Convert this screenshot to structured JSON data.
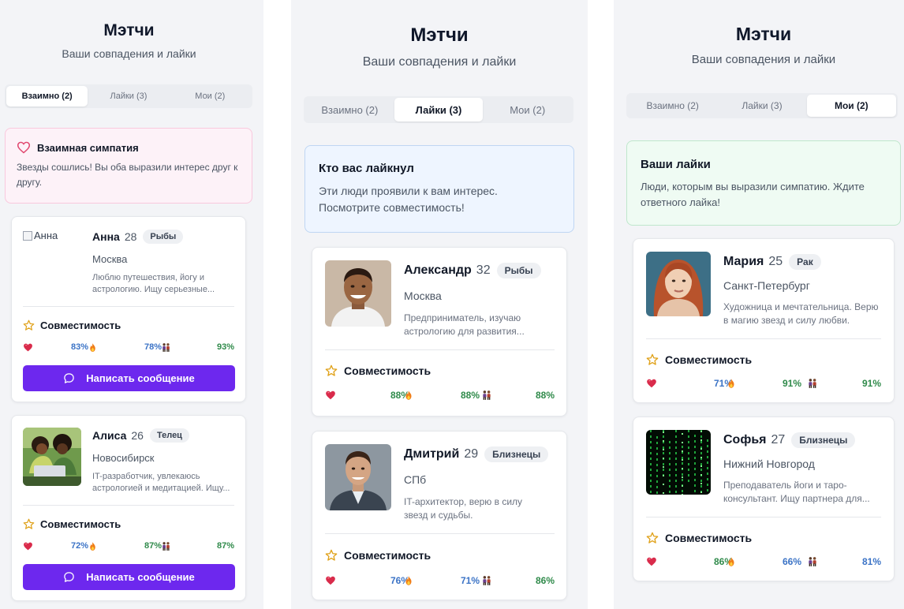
{
  "colors": {
    "accent_purple": "#6d28ee",
    "pct_blue": "#3b73c6",
    "pct_green": "#2f8a4a",
    "banner_pink": "#fdf2f8",
    "banner_blue": "#eef5ff",
    "banner_green": "#effbf3"
  },
  "panels": [
    {
      "title": "Мэтчи",
      "subtitle": "Ваши совпадения и лайки",
      "tabs": [
        {
          "label": "Взаимно (2)",
          "active": true
        },
        {
          "label": "Лайки (3)",
          "active": false
        },
        {
          "label": "Мои (2)",
          "active": false
        }
      ],
      "banner": {
        "icon": "heart-outline-icon",
        "title": "Взаимная симпатия",
        "text": "Звезды сошлись! Вы оба выразили интерес друг к другу."
      },
      "cards": [
        {
          "name": "Анна",
          "age": "28",
          "sign": "Рыбы",
          "city": "Москва",
          "description": "Люблю путешествия, йогу и астрологию. Ищу серьезные...",
          "photo": "broken",
          "photo_alt": "Анна",
          "compat_label": "Совместимость",
          "stats": [
            {
              "icon": "heart-icon",
              "value": "83%",
              "color": "blue"
            },
            {
              "icon": "fire-icon",
              "value": "78%",
              "color": "blue"
            },
            {
              "icon": "couple-icon",
              "value": "93%",
              "color": "green"
            }
          ],
          "button_label": "Написать сообщение"
        },
        {
          "name": "Алиса",
          "age": "26",
          "sign": "Телец",
          "city": "Новосибирск",
          "description": "IT-разработчик, увлекаюсь астрологией и медитацией. Ищу...",
          "photo": "friends-laptop",
          "compat_label": "Совместимость",
          "stats": [
            {
              "icon": "heart-icon",
              "value": "72%",
              "color": "blue"
            },
            {
              "icon": "fire-icon",
              "value": "87%",
              "color": "green"
            },
            {
              "icon": "couple-icon",
              "value": "87%",
              "color": "green"
            }
          ],
          "button_label": "Написать сообщение"
        }
      ]
    },
    {
      "title": "Мэтчи",
      "subtitle": "Ваши совпадения и лайки",
      "tabs": [
        {
          "label": "Взаимно (2)",
          "active": false
        },
        {
          "label": "Лайки (3)",
          "active": true
        },
        {
          "label": "Мои (2)",
          "active": false
        }
      ],
      "banner": {
        "title": "Кто вас лайкнул",
        "text": "Эти люди проявили к вам интерес. Посмотрите совместимость!"
      },
      "cards": [
        {
          "name": "Александр",
          "age": "32",
          "sign": "Рыбы",
          "city": "Москва",
          "description": "Предприниматель, изучаю астрологию для развития...",
          "photo": "man-smiling",
          "compat_label": "Совместимость",
          "stats": [
            {
              "icon": "heart-icon",
              "value": "88%",
              "color": "green"
            },
            {
              "icon": "fire-icon",
              "value": "88%",
              "color": "green"
            },
            {
              "icon": "couple-icon",
              "value": "88%",
              "color": "green"
            }
          ]
        },
        {
          "name": "Дмитрий",
          "age": "29",
          "sign": "Близнецы",
          "city": "СПб",
          "description": "IT-архитектор, верю в силу звезд и судьбы.",
          "photo": "man-suit",
          "compat_label": "Совместимость",
          "stats": [
            {
              "icon": "heart-icon",
              "value": "76%",
              "color": "blue"
            },
            {
              "icon": "fire-icon",
              "value": "71%",
              "color": "blue"
            },
            {
              "icon": "couple-icon",
              "value": "86%",
              "color": "green"
            }
          ]
        }
      ]
    },
    {
      "title": "Мэтчи",
      "subtitle": "Ваши совпадения и лайки",
      "tabs": [
        {
          "label": "Взаимно (2)",
          "active": false
        },
        {
          "label": "Лайки (3)",
          "active": false
        },
        {
          "label": "Мои (2)",
          "active": true
        }
      ],
      "banner": {
        "title": "Ваши лайки",
        "text": "Люди, которым вы выразили симпатию. Ждите ответного лайка!"
      },
      "cards": [
        {
          "name": "Мария",
          "age": "25",
          "sign": "Рак",
          "city": "Санкт-Петербург",
          "description": "Художница и мечтательница. Верю в магию звезд и силу любви.",
          "photo": "woman-redhead",
          "compat_label": "Совместимость",
          "stats": [
            {
              "icon": "heart-icon",
              "value": "71%",
              "color": "blue"
            },
            {
              "icon": "fire-icon",
              "value": "91%",
              "color": "green"
            },
            {
              "icon": "couple-icon",
              "value": "91%",
              "color": "green"
            }
          ]
        },
        {
          "name": "Софья",
          "age": "27",
          "sign": "Близнецы",
          "city": "Нижний Новгород",
          "description": "Преподаватель йоги и таро-консультант. Ищу партнера для...",
          "photo": "matrix-code",
          "compat_label": "Совместимость",
          "stats": [
            {
              "icon": "heart-icon",
              "value": "86%",
              "color": "green"
            },
            {
              "icon": "fire-icon",
              "value": "66%",
              "color": "blue"
            },
            {
              "icon": "couple-icon",
              "value": "81%",
              "color": "blue"
            }
          ]
        }
      ]
    }
  ]
}
